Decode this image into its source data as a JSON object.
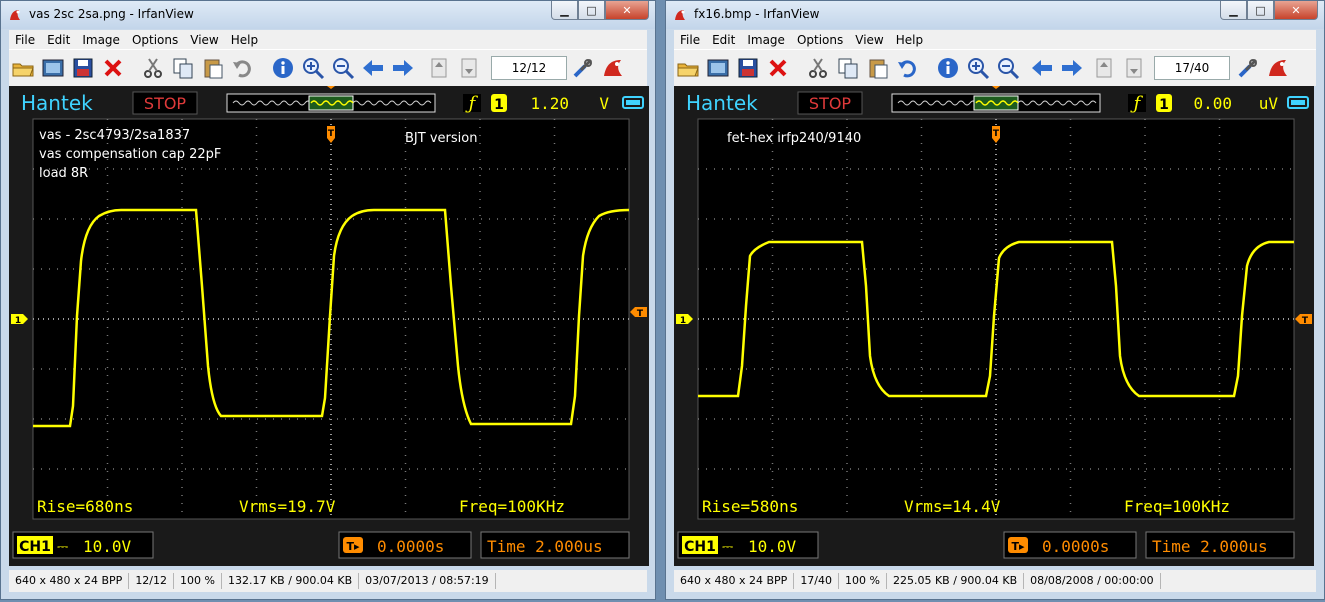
{
  "menu_labels": [
    "File",
    "Edit",
    "Image",
    "Options",
    "View",
    "Help"
  ],
  "colors": {
    "trace": "#ffff00",
    "scope_bg": "#000000",
    "scope_frame": "#1a1a1a",
    "brand": "#3fd3ff",
    "stop": "#e03a3a",
    "button_fill": "#ff8c00",
    "grid": "#777777"
  },
  "windows": [
    {
      "title": "vas 2sc 2sa.png - IrfanView",
      "page": "12/12",
      "scope": {
        "brand": "Hantek",
        "status": "STOP",
        "trigger_level": "1.20",
        "trigger_unit": "V",
        "annotations": [
          "vas - 2sc4793/2sa1837",
          "vas compensation cap 22pF",
          "load 8R",
          "BJT version"
        ],
        "rise": "Rise=680ns",
        "vrms": "Vrms=19.7V",
        "freq": "Freq=100KHz",
        "channel": "CH1",
        "volts_div": "10.0V",
        "trigger_time": "0.0000s",
        "timebase": "Time 2.000us"
      },
      "status": [
        "640 x 480 x 24 BPP",
        "12/12",
        "100 %",
        "132.17 KB / 900.04 KB",
        "03/07/2013 / 08:57:19"
      ]
    },
    {
      "title": "fx16.bmp - IrfanView",
      "page": "17/40",
      "scope": {
        "brand": "Hantek",
        "status": "STOP",
        "trigger_level": "0.00",
        "trigger_unit": "uV",
        "annotations": [
          "fet-hex irfp240/9140"
        ],
        "rise": "Rise=580ns",
        "vrms": "Vrms=14.4V",
        "freq": "Freq=100KHz",
        "channel": "CH1",
        "volts_div": "10.0V",
        "trigger_time": "0.0000s",
        "timebase": "Time 2.000us"
      },
      "status": [
        "640 x 480 x 24 BPP",
        "17/40",
        "100 %",
        "225.05 KB / 900.04 KB",
        "08/08/2008 / 00:00:00"
      ]
    }
  ]
}
